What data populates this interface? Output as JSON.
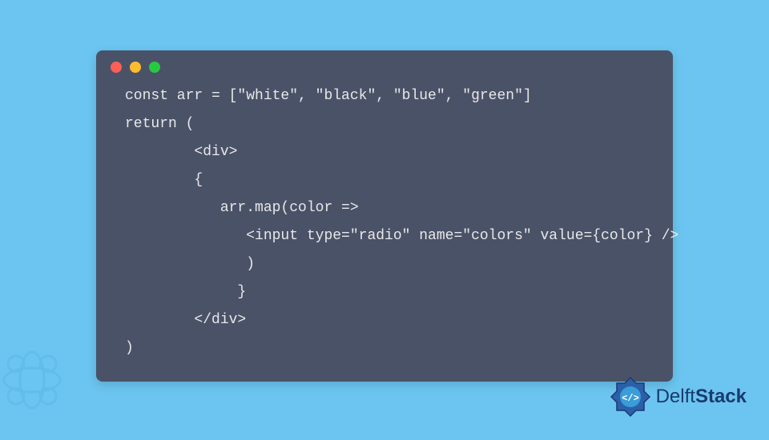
{
  "code": {
    "lines": [
      "const arr = [\"white\", \"black\", \"blue\", \"green\"]",
      "return (",
      "        <div>",
      "        {",
      "           arr.map(color =>",
      "              <input type=\"radio\" name=\"colors\" value={color} />",
      "              )",
      "             }",
      "        </div>",
      ")"
    ]
  },
  "brand": {
    "name_part1": "Delft",
    "name_part2": "Stack"
  },
  "colors": {
    "background": "#6bc5f0",
    "window": "#4a5268",
    "text": "#e8e8e8",
    "brand": "#1a3a6e"
  }
}
